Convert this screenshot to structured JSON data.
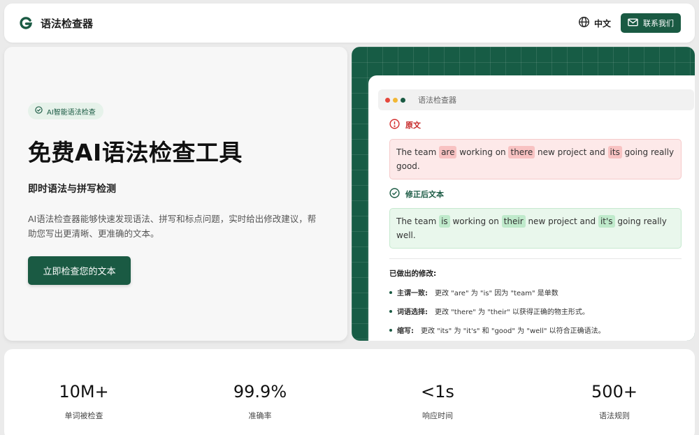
{
  "header": {
    "logo_letter": "G",
    "app_name": "语法检查器",
    "language": "中文",
    "contact_label": "联系我们",
    "brand_color": "#1a5a43"
  },
  "hero": {
    "badge": "AI智能语法检查",
    "title": "免费AI语法检查工具",
    "subtitle": "即时语法与拼写检测",
    "description": "AI语法检查器能够快速发现语法、拼写和标点问题，实时给出修改建议，帮助您写出更清晰、更准确的文本。",
    "cta_label": "立即检查您的文本"
  },
  "demo": {
    "window_title": "语法检查器",
    "window_dots": [
      "#e5473c",
      "#f2b735",
      "#1a5a43"
    ],
    "original_label": "原文",
    "original_segments": [
      {
        "text": "The team ",
        "hl": false
      },
      {
        "text": "are",
        "hl": true
      },
      {
        "text": " working on ",
        "hl": false
      },
      {
        "text": "there",
        "hl": true
      },
      {
        "text": " new project and ",
        "hl": false
      },
      {
        "text": "its",
        "hl": true
      },
      {
        "text": " going really good.",
        "hl": false
      }
    ],
    "corrected_label": "修正后文本",
    "corrected_segments": [
      {
        "text": "The team ",
        "hl": false
      },
      {
        "text": "is",
        "hl": true
      },
      {
        "text": " working on ",
        "hl": false
      },
      {
        "text": "their",
        "hl": true
      },
      {
        "text": " new project and ",
        "hl": false
      },
      {
        "text": "it's",
        "hl": true
      },
      {
        "text": " going really well.",
        "hl": false
      }
    ],
    "changes_title": "已做出的修改:",
    "changes": [
      {
        "label": "主谓一致:",
        "text": "更改 \"are\" 为 \"is\" 因为 \"team\" 是单数"
      },
      {
        "label": "词语选择:",
        "text": "更改 \"there\" 为 \"their\" 以获得正确的物主形式。"
      },
      {
        "label": "缩写:",
        "text": "更改 \"its\" 为 \"it's\" 和 \"good\" 为 \"well\" 以符合正确语法。"
      }
    ]
  },
  "stats": [
    {
      "value": "10M+",
      "label": "单词被检查"
    },
    {
      "value": "99.9%",
      "label": "准确率"
    },
    {
      "value": "<1s",
      "label": "响应时间"
    },
    {
      "value": "500+",
      "label": "语法规则"
    }
  ]
}
